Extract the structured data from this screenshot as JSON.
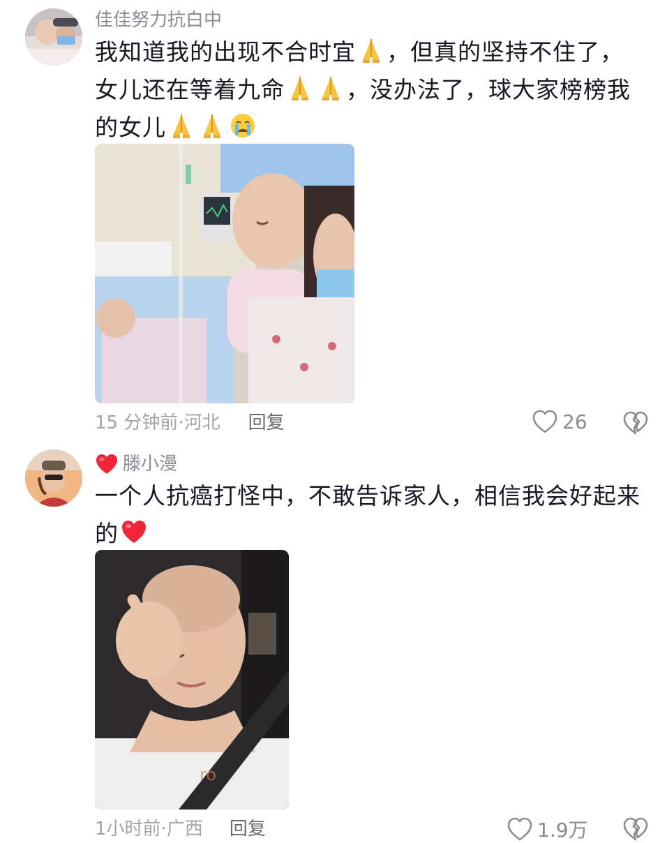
{
  "comments": [
    {
      "username": "佳佳努力抗白中",
      "text_lines": [
        {
          "parts": [
            "我知道我的出现不合时宜",
            "pray",
            "，但真的坚持不住了，"
          ]
        },
        {
          "parts": [
            "女儿还在等着九命",
            "pray",
            "pray",
            "，没办法了，球大家榜榜我"
          ]
        },
        {
          "parts": [
            "的女儿",
            "pray",
            "pray",
            "cry"
          ]
        }
      ],
      "line1_a": "我知道我的出现不合时宜",
      "line1_b": "，但真的坚持不住了，",
      "line2_a": "女儿还在等着九命",
      "line2_b": "，没办法了，球大家榜榜我",
      "line3_a": "的女儿",
      "time": "15 分钟前",
      "location": "河北",
      "separator": " · ",
      "reply_label": "回复",
      "like_count": "26",
      "photo_subject": "hospital-bed-photo"
    },
    {
      "username": "滕小漫",
      "badge": "red-heart-icon",
      "line1": "一个人抗癌打怪中，不敢告诉家人，相信我会好起来",
      "line2_a": "的",
      "time": "1小时前",
      "location": "广西",
      "separator": " · ",
      "reply_label": "回复",
      "like_count": "1.9万",
      "photo_subject": "selfie-photo"
    }
  ],
  "colors": {
    "text": "#161823",
    "meta": "#a3a4a8",
    "username": "#8a8b91"
  }
}
